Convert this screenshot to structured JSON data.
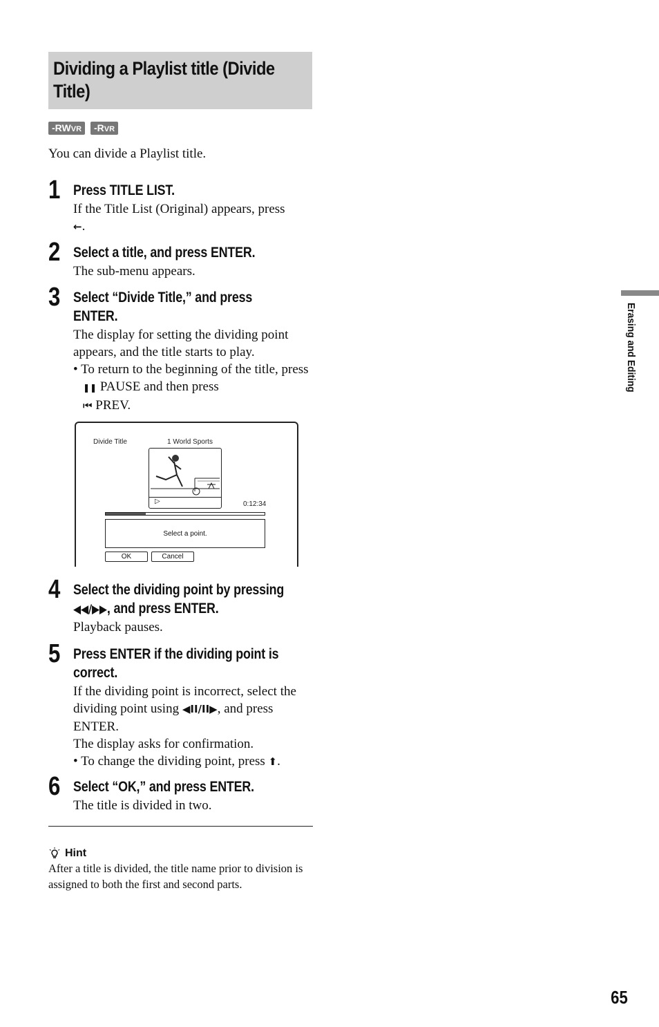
{
  "section": {
    "title": "Dividing a Playlist title (Divide Title)",
    "badges": [
      {
        "main": "-RW",
        "sub": "VR"
      },
      {
        "main": "-R",
        "sub": "VR"
      }
    ],
    "intro": "You can divide a Playlist title."
  },
  "steps": [
    {
      "num": "1",
      "title": "Press TITLE LIST.",
      "body": "If the Title List (Original) appears, press",
      "icon": "←",
      "icon_suffix": "."
    },
    {
      "num": "2",
      "title": "Select a title, and press ENTER.",
      "body": "The sub-menu appears."
    },
    {
      "num": "3",
      "title_line1": "Select “Divide Title,” and press",
      "title_line2": "ENTER.",
      "body": "The display for setting the dividing point appears, and the title starts to play.",
      "bullet_a": "To return to the beginning of the title, press",
      "pause_icon": "❚❚",
      "pause_label": "PAUSE and then press",
      "prev_icon": "⏮",
      "prev_label": "PREV."
    },
    {
      "num": "4",
      "title_line1": "Select the dividing point by pressing",
      "title_icons": "◀◀/▶▶",
      "title_line2": ", and press ENTER.",
      "body": "Playback pauses."
    },
    {
      "num": "5",
      "title_line1": "Press ENTER if the dividing point is",
      "title_line2": "correct.",
      "body_a": "If the dividing point is incorrect, select the dividing point using",
      "body_icons": "◀II/II▶",
      "body_b": ", and press ENTER.",
      "body_c": "The display asks for confirmation.",
      "bullet": "To change the dividing point, press",
      "bullet_icon": "⬆",
      "bullet_suffix": "."
    },
    {
      "num": "6",
      "title": "Select “OK,” and press ENTER.",
      "body": "The title is divided in two."
    }
  ],
  "screen": {
    "label": "Divide Title",
    "title_name": "1 World Sports",
    "play_icon": "▷",
    "time": "0:12:34",
    "progress": 0.25,
    "message": "Select a point.",
    "ok_label": "OK",
    "cancel_label": "Cancel"
  },
  "hint": {
    "title": "Hint",
    "body": "After a title is divided, the title name prior to division is assigned to both the first and second parts."
  },
  "side_tab": "Erasing and Editing",
  "page_number": "65"
}
